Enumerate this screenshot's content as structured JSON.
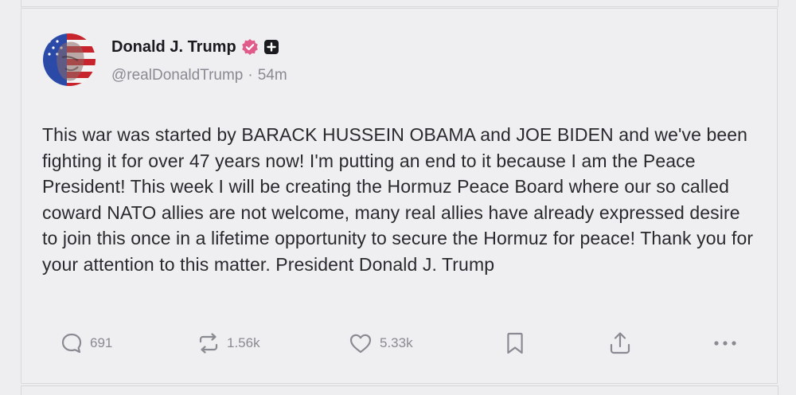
{
  "post": {
    "author": {
      "display_name": "Donald J. Trump",
      "handle": "@realDonaldTrump",
      "separator": "·",
      "time_ago": "54m",
      "avatar_icon": "flag-portrait-avatar",
      "verified_icon": "verified-badge-icon",
      "follow_icon": "plus-badge-icon"
    },
    "body": "This war was started by BARACK HUSSEIN OBAMA and JOE BIDEN and we've been fighting it for over 47 years now! I'm putting an end to it because I am the Peace President! This week I will be creating the Hormuz Peace Board where our so called coward NATO allies are not welcome, many real allies have already expressed desire to join this once in a lifetime opportunity to secure the Hormuz for peace! Thank you for your attention to this matter. President Donald J. Trump",
    "actions": {
      "reply": {
        "icon": "reply-icon",
        "count": "691"
      },
      "repost": {
        "icon": "repost-icon",
        "count": "1.56k"
      },
      "like": {
        "icon": "heart-icon",
        "count": "5.33k"
      },
      "bookmark": {
        "icon": "bookmark-icon"
      },
      "share": {
        "icon": "share-icon"
      },
      "more": {
        "icon": "more-icon"
      }
    }
  },
  "colors": {
    "background": "#eeeef0",
    "text": "#2a2a2e",
    "muted": "#8a8a92",
    "verified": "#e05a8a"
  }
}
